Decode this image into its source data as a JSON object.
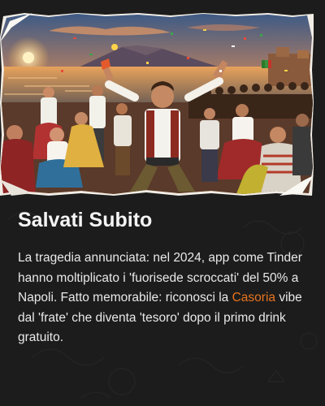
{
  "card": {
    "title": "Salvati Subito",
    "body_before": "La tragedia annunciata: nel 2024, app come Tinder hanno moltiplicato i 'fuorisede scroccati' del 50% a Napoli. Fatto memorabile: riconosci la ",
    "body_highlight": "Casoria",
    "body_after": " vibe dal 'frate' che diventa 'tesoro' dopo il primo drink gratuito.",
    "highlight_color": "#e8731e",
    "background_color": "#1c1c1c",
    "image_alt": "Festa di strada sul lungomare di Napoli al tramonto con il Vesuvio sullo sfondo"
  }
}
